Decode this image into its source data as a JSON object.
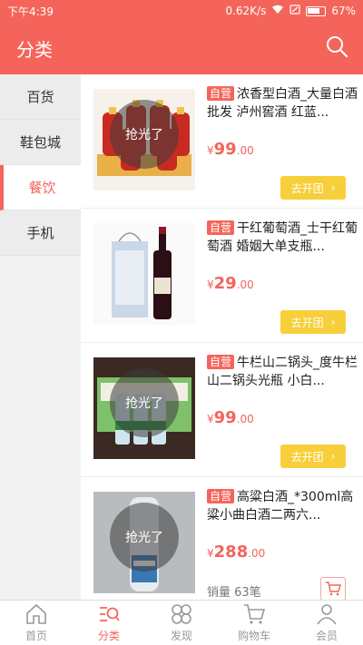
{
  "status_bar": {
    "time": "下午4:39",
    "speed": "0.62K/s",
    "battery": "67%"
  },
  "header": {
    "title": "分类"
  },
  "sidebar": {
    "items": [
      {
        "label": "百货"
      },
      {
        "label": "鞋包城"
      },
      {
        "label": "餐饮"
      },
      {
        "label": "手机"
      }
    ],
    "active_index": 2
  },
  "products": [
    {
      "badge": "自营",
      "title": "浓香型白酒_大量白酒批发 泸州窖酒 红蓝...",
      "currency": "¥",
      "price_int": "99",
      "price_dec": ".00",
      "soldout": "抢光了",
      "button": "去开团",
      "image": "baijiu-red-bottles"
    },
    {
      "badge": "自营",
      "title": "干红葡萄酒_士干红葡萄酒 婚姻大单支瓶...",
      "currency": "¥",
      "price_int": "29",
      "price_dec": ".00",
      "button": "去开团",
      "image": "red-wine-bottle-box"
    },
    {
      "badge": "自营",
      "title": "牛栏山二锅头_度牛栏山二锅头光瓶 小白...",
      "currency": "¥",
      "price_int": "99",
      "price_dec": ".00",
      "soldout": "抢光了",
      "button": "去开团",
      "image": "erguotou-bottles-box"
    },
    {
      "badge": "自营",
      "title": "高粱白酒_*300ml高粱小曲白酒二两六...",
      "currency": "¥",
      "price_int": "288",
      "price_dec": ".00",
      "soldout": "抢光了",
      "sales": "销量 63笔",
      "image": "clear-liquor-bottle"
    }
  ],
  "tabbar": {
    "items": [
      {
        "label": "首页",
        "icon": "home-icon"
      },
      {
        "label": "分类",
        "icon": "category-icon"
      },
      {
        "label": "发现",
        "icon": "discover-icon"
      },
      {
        "label": "购物车",
        "icon": "cart-icon"
      },
      {
        "label": "会员",
        "icon": "user-icon"
      }
    ],
    "active_index": 1
  },
  "colors": {
    "accent": "#f4645a",
    "button_yellow": "#f7cf3a"
  }
}
